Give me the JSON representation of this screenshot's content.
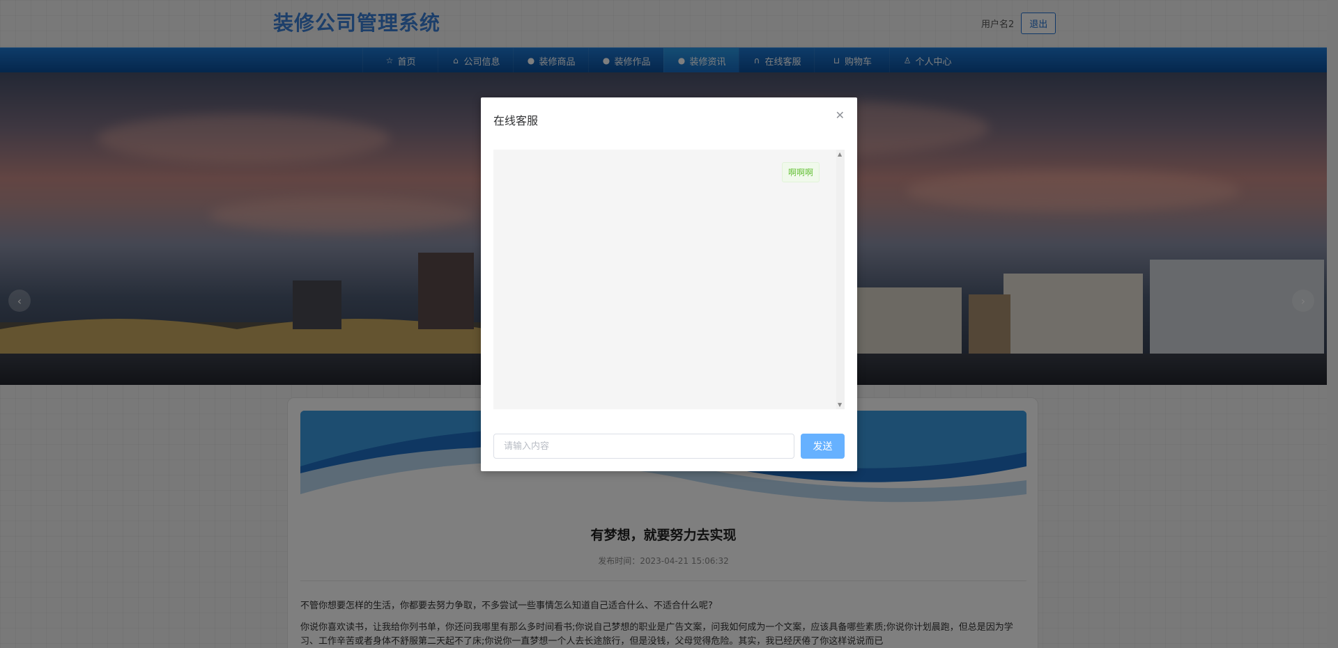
{
  "header": {
    "site_title": "装修公司管理系统",
    "username": "用户名2",
    "logout_label": "退出"
  },
  "nav": {
    "items": [
      {
        "label": "首页",
        "icon": "star-icon"
      },
      {
        "label": "公司信息",
        "icon": "shop-icon"
      },
      {
        "label": "装修商品",
        "icon": "info-circle-icon"
      },
      {
        "label": "装修作品",
        "icon": "question-circle-icon"
      },
      {
        "label": "装修资讯",
        "icon": "info-circle-icon"
      },
      {
        "label": "在线客服",
        "icon": "headset-icon"
      },
      {
        "label": "购物车",
        "icon": "cart-icon"
      },
      {
        "label": "个人中心",
        "icon": "user-icon"
      }
    ],
    "active_index": 4
  },
  "article": {
    "title": "有梦想，就要努力去实现",
    "publish_time": "发布时间：2023-04-21 15:06:32",
    "paragraph1": "不管你想要怎样的生活，你都要去努力争取，不多尝试一些事情怎么知道自己适合什么、不适合什么呢?",
    "paragraph2": "你说你喜欢读书，让我给你列书单，你还问我哪里有那么多时间看书;你说自己梦想的职业是广告文案，问我如何成为一个文案，应该具备哪些素质;你说你计划晨跑，但总是因为学习、工作辛苦或者身体不舒服第二天起不了床;你说你一直梦想一个人去长途旅行，但是没钱，父母觉得危险。其实，我已经厌倦了你这样说说而已"
  },
  "dialog": {
    "title": "在线客服",
    "messages": [
      {
        "text": "啊啊啊",
        "side": "right"
      }
    ],
    "input_placeholder": "请输入内容",
    "send_label": "发送"
  },
  "colors": {
    "brand_title": "#3a7fd5",
    "nav_bg": "#0a4e9a",
    "send_button": "#66b1ff",
    "message_bubble_text": "#67c23a"
  }
}
